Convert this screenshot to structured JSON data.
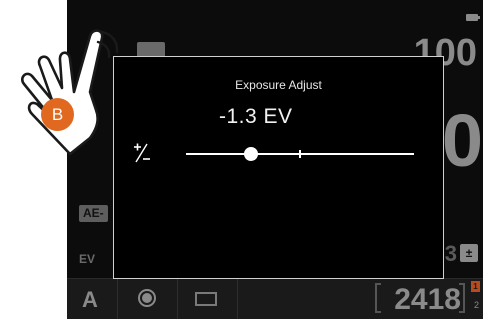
{
  "camera": {
    "iso_value": "100",
    "aperture_value": "0",
    "left_partial": "/",
    "ae_lock_label": "AE-",
    "ev_label": "EV",
    "partial_digit": "3",
    "ev_comp_icon": "ev-compensation-icon",
    "battery_icon": "battery-icon"
  },
  "bottom_bar": {
    "mode_letter": "A",
    "record_icon": "record-icon",
    "frame_icon": "frame-icon",
    "shots_remaining": "2418",
    "card_slot_1": "1",
    "card_slot_2": "2"
  },
  "dialog": {
    "title": "Exposure Adjust",
    "readout": "-1.3 EV",
    "plus_minus_icon": "plus-minus-icon",
    "slider": {
      "min": -3,
      "max": 3,
      "value": -1.3,
      "center": 0
    }
  },
  "overlay": {
    "hand_icon": "tap-hand-icon",
    "badge_label": "B",
    "badge_color": "#e0681f"
  }
}
